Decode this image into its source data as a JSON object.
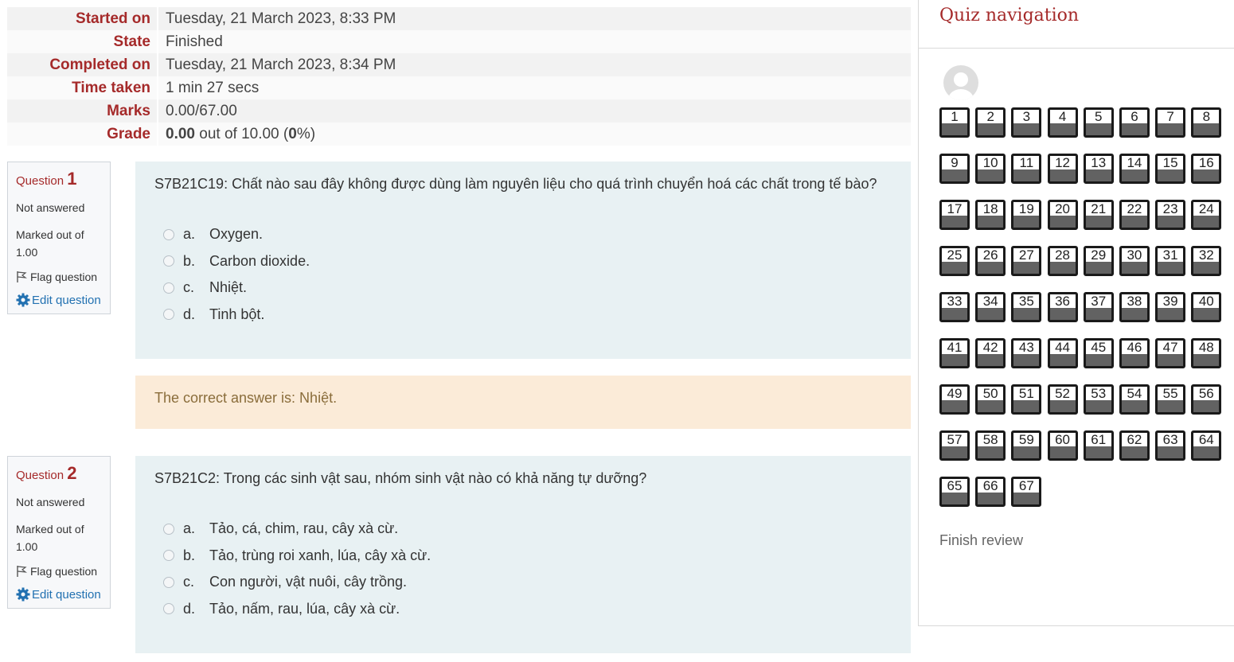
{
  "summary": [
    {
      "label": "Started on",
      "value": "Tuesday, 21 March 2023, 8:33 PM"
    },
    {
      "label": "State",
      "value": "Finished"
    },
    {
      "label": "Completed on",
      "value": "Tuesday, 21 March 2023, 8:34 PM"
    },
    {
      "label": "Time taken",
      "value": "1 min 27 secs"
    },
    {
      "label": "Marks",
      "value": "0.00/67.00"
    }
  ],
  "grade": {
    "label": "Grade",
    "score": "0.00",
    "mid": " out of 10.00 (",
    "pct": "0",
    "end": "%)"
  },
  "questions": [
    {
      "prefix": "Question ",
      "number": "1",
      "status": "Not answered",
      "marked": "Marked out of 1.00",
      "flag": "Flag question",
      "edit": "Edit question",
      "text": "S7B21C19: Chất nào sau đây không được dùng làm nguyên liệu cho quá trình chuyển hoá các chất trong tế bào?",
      "answers": [
        {
          "letter": "a.",
          "text": "Oxygen."
        },
        {
          "letter": "b.",
          "text": "Carbon dioxide."
        },
        {
          "letter": "c.",
          "text": "Nhiệt."
        },
        {
          "letter": "d.",
          "text": "Tinh bột."
        }
      ],
      "feedback": "The correct answer is: Nhiệt."
    },
    {
      "prefix": "Question ",
      "number": "2",
      "status": "Not answered",
      "marked": "Marked out of 1.00",
      "flag": "Flag question",
      "edit": "Edit question",
      "text": "S7B21C2: Trong các sinh vật sau, nhóm sinh vật nào có khả năng tự dưỡng?",
      "answers": [
        {
          "letter": "a.",
          "text": "Tảo, cá, chim, rau, cây xà cừ."
        },
        {
          "letter": "b.",
          "text": "Tảo, trùng roi xanh, lúa, cây xà cừ."
        },
        {
          "letter": "c.",
          "text": "Con người, vật nuôi, cây trồng."
        },
        {
          "letter": "d.",
          "text": "Tảo, nấm, rau, lúa, cây xà cừ."
        }
      ]
    }
  ],
  "nav": {
    "title": "Quiz navigation",
    "question_count": 67,
    "finish": "Finish review"
  },
  "colors": {
    "label_red": "#a52a2a",
    "link_blue": "#2271b1",
    "question_bg": "#e8f1f3",
    "feedback_bg": "#fbebd8"
  }
}
